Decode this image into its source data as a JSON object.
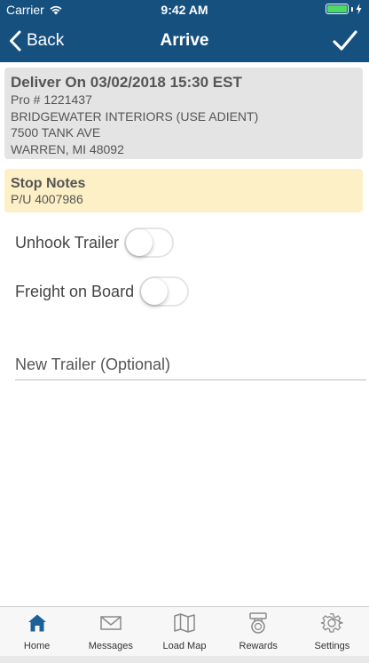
{
  "status_bar": {
    "carrier": "Carrier",
    "time": "9:42 AM",
    "battery_level": 1.0
  },
  "nav": {
    "back_label": "Back",
    "title": "Arrive",
    "icons": {
      "back": "chevron-left-icon",
      "done": "checkmark-icon"
    }
  },
  "delivery": {
    "title": "Deliver On 03/02/2018 15:30 EST",
    "pro_number": "Pro # 1221437",
    "company": "BRIDGEWATER INTERIORS (USE ADIENT)",
    "address_line": "7500 TANK AVE",
    "city_line": "WARREN, MI 48092"
  },
  "stop_notes": {
    "title": "Stop Notes",
    "text": "P/U 4007986"
  },
  "toggles": {
    "unhook_trailer": {
      "label": "Unhook Trailer",
      "on": false
    },
    "freight_on_board": {
      "label": "Freight on Board",
      "on": false
    }
  },
  "new_trailer": {
    "placeholder": "New Trailer (Optional)",
    "value": ""
  },
  "tabs": [
    {
      "label": "Home",
      "icon": "home-icon",
      "active": true
    },
    {
      "label": "Messages",
      "icon": "envelope-icon",
      "active": false
    },
    {
      "label": "Load Map",
      "icon": "map-icon",
      "active": false
    },
    {
      "label": "Rewards",
      "icon": "rewards-icon",
      "active": false
    },
    {
      "label": "Settings",
      "icon": "gear-icon",
      "active": false
    }
  ],
  "colors": {
    "brand": "#16507f",
    "active_tab": "#1d6296",
    "inactive_tab": "#8a8a8a",
    "notes_bg": "#fdf0c6",
    "card_bg": "#e4e4e4",
    "battery": "#4cd964"
  }
}
